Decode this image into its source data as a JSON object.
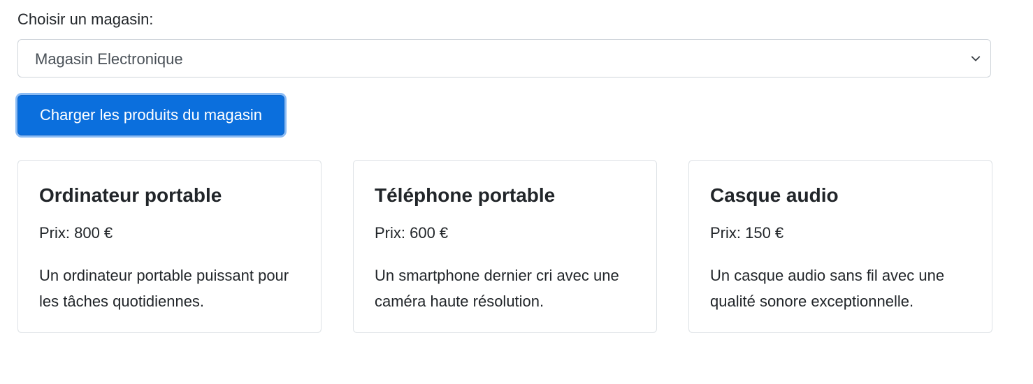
{
  "form": {
    "label": "Choisir un magasin:",
    "selected_store": "Magasin Electronique",
    "load_button": "Charger les produits du magasin"
  },
  "products": [
    {
      "name": "Ordinateur portable",
      "price": "Prix: 800 €",
      "description": "Un ordinateur portable puissant pour les tâches quotidiennes."
    },
    {
      "name": "Téléphone portable",
      "price": "Prix: 600 €",
      "description": "Un smartphone dernier cri avec une caméra haute résolution."
    },
    {
      "name": "Casque audio",
      "price": "Prix: 150 €",
      "description": "Un casque audio sans fil avec une qualité sonore exceptionnelle."
    }
  ],
  "colors": {
    "primary": "#0b6fdd",
    "focus_ring": "#8bbcf5",
    "text": "#212529",
    "border": "#dee2e6"
  },
  "icons": {
    "select": "chevron-down-icon"
  }
}
